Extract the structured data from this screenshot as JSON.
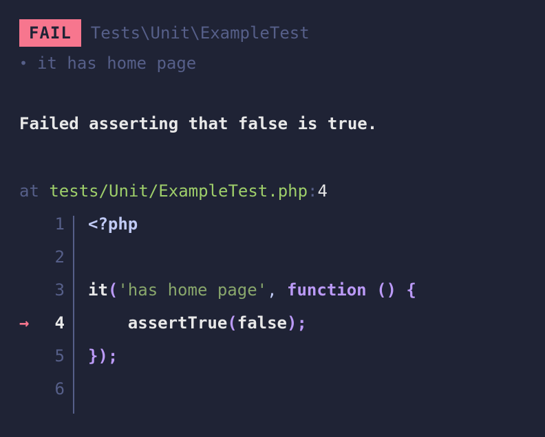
{
  "header": {
    "badge": "FAIL",
    "test_class": "Tests\\Unit\\ExampleTest"
  },
  "test": {
    "bullet": "•",
    "name": "it has home page"
  },
  "error": {
    "message": "Failed asserting that false is true."
  },
  "location": {
    "at": "at",
    "file": "tests/Unit/ExampleTest.php",
    "sep": ":",
    "line": "4"
  },
  "code": {
    "arrow": "→",
    "lines": [
      {
        "num": "1",
        "active": false
      },
      {
        "num": "2",
        "active": false
      },
      {
        "num": "3",
        "active": false
      },
      {
        "num": "4",
        "active": true
      },
      {
        "num": "5",
        "active": false
      },
      {
        "num": "6",
        "active": false
      }
    ],
    "tokens": {
      "open_tag": "<?php",
      "it": "it",
      "lparen1": "(",
      "str_home": "'has home page'",
      "comma": ", ",
      "function": "function",
      "space1": " ",
      "unit_paren": "()",
      "space2": " ",
      "lbrace": "{",
      "indent4": "    ",
      "assertTrue": "assertTrue",
      "lparen2": "(",
      "false_kw": "false",
      "rparen2": ")",
      "semi": ";",
      "rbrace": "}",
      "rparen1": ")",
      "semi2": ";"
    }
  }
}
